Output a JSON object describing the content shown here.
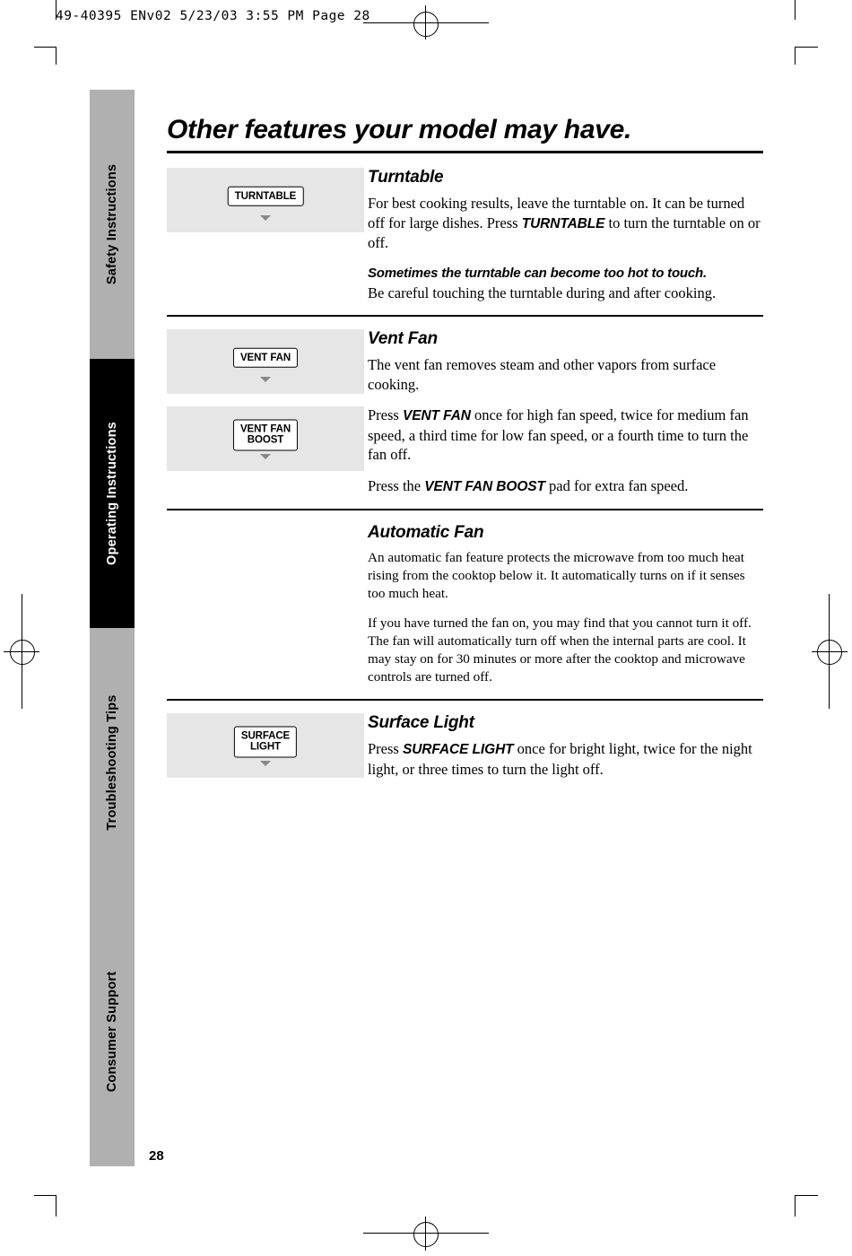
{
  "print_header": "49-40395 ENv02  5/23/03  3:55 PM  Page 28",
  "sidebar": {
    "tabs": [
      {
        "label": "Safety Instructions",
        "style": "grey"
      },
      {
        "label": "Operating Instructions",
        "style": "dark"
      },
      {
        "label": "Troubleshooting Tips",
        "style": "grey"
      },
      {
        "label": "Consumer Support",
        "style": "grey"
      }
    ]
  },
  "page": {
    "title": "Other features your model may have.",
    "number": "28"
  },
  "sections": [
    {
      "id": "turntable",
      "heading": "Turntable",
      "pads": [
        {
          "label": "TURNTABLE"
        }
      ],
      "paragraphs": [
        {
          "type": "body",
          "runs": [
            {
              "text": "For best cooking results, leave the turntable on. It can be turned off for large dishes. Press ",
              "style": "normal"
            },
            {
              "text": "TURNTABLE",
              "style": "bold-italic-sans"
            },
            {
              "text": " to turn the turntable on or off.",
              "style": "normal"
            }
          ]
        },
        {
          "type": "callout",
          "runs": [
            {
              "text": "Sometimes the turntable can become too hot to touch.",
              "style": "callout"
            }
          ]
        },
        {
          "type": "body",
          "runs": [
            {
              "text": "Be careful touching the turntable during and after cooking.",
              "style": "normal"
            }
          ]
        }
      ]
    },
    {
      "id": "vent-fan",
      "heading": "Vent Fan",
      "pads": [
        {
          "label": "VENT FAN"
        },
        {
          "label": "VENT FAN\nBOOST"
        }
      ],
      "paragraphs": [
        {
          "type": "body",
          "runs": [
            {
              "text": "The vent fan removes steam and other vapors from surface cooking.",
              "style": "normal"
            }
          ]
        },
        {
          "type": "body",
          "runs": [
            {
              "text": "Press ",
              "style": "normal"
            },
            {
              "text": "VENT FAN",
              "style": "bold-italic-sans"
            },
            {
              "text": " once for high fan speed, twice for medium fan speed, a third time for low fan speed, or a fourth time to turn the fan off.",
              "style": "normal"
            }
          ]
        },
        {
          "type": "body",
          "runs": [
            {
              "text": "Press the ",
              "style": "normal"
            },
            {
              "text": "VENT FAN BOOST",
              "style": "bold-italic-sans"
            },
            {
              "text": " pad for extra fan speed.",
              "style": "normal"
            }
          ]
        }
      ]
    },
    {
      "id": "automatic-fan",
      "heading": "Automatic Fan",
      "pads": [],
      "paragraphs": [
        {
          "type": "body-small",
          "runs": [
            {
              "text": "An automatic fan feature protects the microwave from too much heat rising from the cooktop below it. It automatically turns on if it senses too much heat.",
              "style": "normal"
            }
          ]
        },
        {
          "type": "body-small",
          "runs": [
            {
              "text": "If you have turned the fan on, you may find that you cannot turn it off. The fan will automatically turn off when the internal parts are cool. It may stay on for 30 minutes or more after the cooktop and microwave controls are turned off.",
              "style": "normal"
            }
          ]
        }
      ]
    },
    {
      "id": "surface-light",
      "heading": "Surface Light",
      "pads": [
        {
          "label": "SURFACE\nLIGHT"
        }
      ],
      "paragraphs": [
        {
          "type": "body",
          "runs": [
            {
              "text": "Press ",
              "style": "normal"
            },
            {
              "text": "SURFACE LIGHT",
              "style": "bold-italic-sans"
            },
            {
              "text": " once for bright light, twice for the night light, or three times to turn the light off.",
              "style": "normal"
            }
          ]
        }
      ]
    }
  ]
}
